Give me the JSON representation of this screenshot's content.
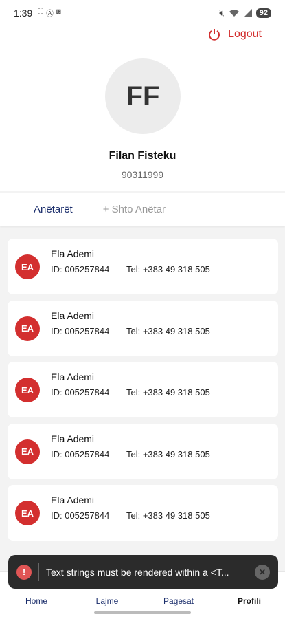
{
  "status_bar": {
    "time": "1:39",
    "battery": "92"
  },
  "header": {
    "logout_label": "Logout",
    "avatar_initials": "FF",
    "user_name": "Filan Fisteku",
    "user_id": "90311999"
  },
  "tabs": [
    {
      "label": "Anëtarët"
    },
    {
      "label": "+ Shto Anëtar"
    }
  ],
  "members": [
    {
      "initials": "EA",
      "name": "Ela Ademi",
      "id": "ID: 005257844",
      "tel": "Tel: +383 49 318 505"
    },
    {
      "initials": "EA",
      "name": "Ela Ademi",
      "id": "ID: 005257844",
      "tel": "Tel: +383 49 318 505"
    },
    {
      "initials": "EA",
      "name": "Ela Ademi",
      "id": "ID: 005257844",
      "tel": "Tel: +383 49 318 505"
    },
    {
      "initials": "EA",
      "name": "Ela Ademi",
      "id": "ID: 005257844",
      "tel": "Tel: +383 49 318 505"
    },
    {
      "initials": "EA",
      "name": "Ela Ademi",
      "id": "ID: 005257844",
      "tel": "Tel: +383 49 318 505"
    }
  ],
  "bottom_nav": [
    {
      "label": "Home",
      "icon": "home-icon"
    },
    {
      "label": "Lajme",
      "icon": "news-icon"
    },
    {
      "label": "Pagesat",
      "icon": "payments-icon"
    },
    {
      "label": "Profili",
      "icon": "profile-icon",
      "active": true
    }
  ],
  "toast": {
    "message": "Text strings must be rendered within a <T..."
  },
  "colors": {
    "accent_red": "#d32f2f",
    "brand_navy": "#1a2d6b",
    "background": "#f3f3f3"
  }
}
